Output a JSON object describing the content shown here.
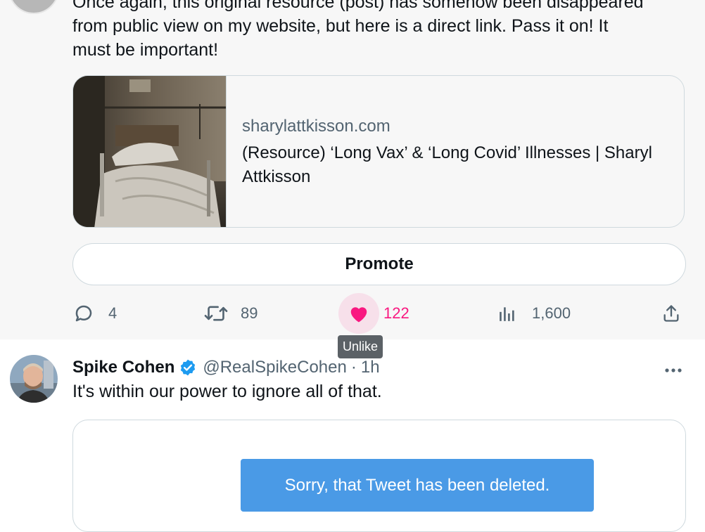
{
  "tweet1": {
    "text_line0": "Once again, this original resource (post) has somehow been disappeared",
    "text_line1": "from public view on my website, but here is a direct link. Pass it on! It",
    "text_line2": "must be important!",
    "card": {
      "domain": "sharylattkisson.com",
      "title": "(Resource) ‘Long Vax’ & ‘Long Covid’ Illnesses | Sharyl Attkisson"
    },
    "promote_label": "Promote",
    "actions": {
      "reply_icon": "reply-icon",
      "reply_count": "4",
      "retweet_icon": "retweet-icon",
      "retweet_count": "89",
      "like_icon": "heart-filled-icon",
      "like_count": "122",
      "views_icon": "analytics-icon",
      "views_count": "1,600",
      "share_icon": "share-icon"
    },
    "tooltip": "Unlike"
  },
  "tweet2": {
    "author_name": "Spike Cohen",
    "verified_icon": "verified-badge-icon",
    "handle": "@RealSpikeCohen",
    "separator": "·",
    "time": "1h",
    "more_icon": "more-icon",
    "text": "It's within our power to ignore all of that.",
    "quoted_status": "Sorry, that Tweet has been deleted."
  },
  "colors": {
    "like_pink": "#f91880",
    "verified_blue": "#1d9bf0",
    "muted_gray": "#536471",
    "deleted_banner": "#4a9ae6"
  }
}
